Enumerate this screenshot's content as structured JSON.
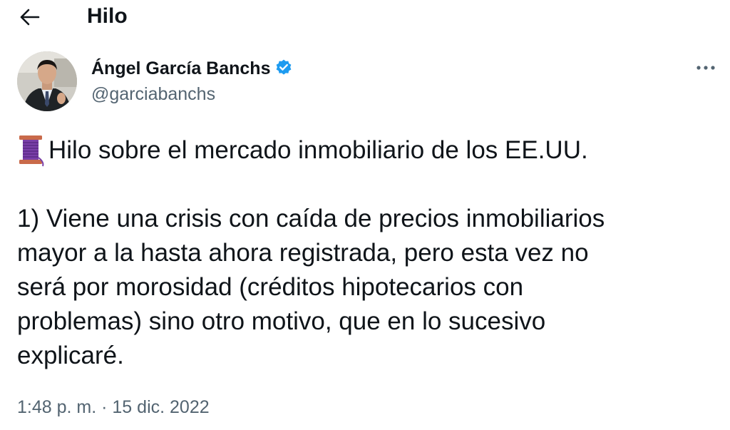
{
  "header": {
    "title": "Hilo",
    "back_icon": "arrow-left-icon"
  },
  "tweet": {
    "author_name": "Ángel García Banchs",
    "author_handle": "@garciabanchs",
    "verified_icon": "verified-badge-icon",
    "more_icon": "more-horizontal-icon",
    "thread_emoji": "thread-spool-icon",
    "lines": [
      "Hilo sobre el mercado inmobiliario de los EE.UU.",
      "1) Viene una crisis con caída de precios inmobiliarios",
      "mayor a la hasta ahora registrada, pero esta vez no",
      "será por morosidad (créditos hipotecarios con",
      "problemas) sino otro motivo, que en lo sucesivo",
      "explicaré."
    ],
    "time": "1:48 p. m.",
    "separator": "·",
    "date": "15 dic. 2022"
  },
  "colors": {
    "text": "#0f1419",
    "secondary": "#536471",
    "verified": "#1d9bf0"
  }
}
